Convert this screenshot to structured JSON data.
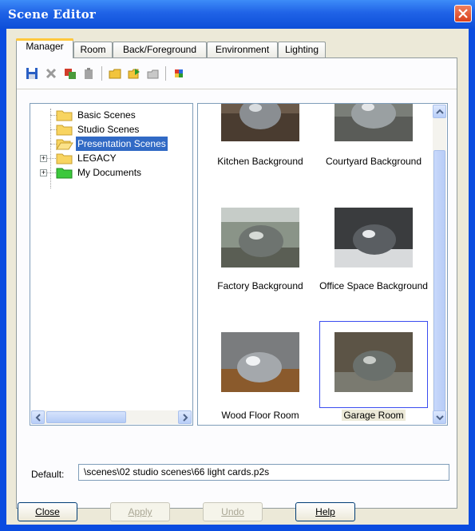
{
  "window": {
    "title": "Scene Editor"
  },
  "tabs": [
    {
      "label": "Manager",
      "active": true
    },
    {
      "label": "Room",
      "active": false
    },
    {
      "label": "Back/Foreground",
      "active": false
    },
    {
      "label": "Environment",
      "active": false
    },
    {
      "label": "Lighting",
      "active": false
    }
  ],
  "toolbar": {
    "icons": [
      "save-icon",
      "delete-icon",
      "copy-icon",
      "paste-icon",
      "new-folder-icon",
      "open-folder-icon",
      "up-folder-icon",
      "color-icon"
    ]
  },
  "tree": {
    "items": [
      {
        "label": "Basic Scenes",
        "icon": "folder-icon"
      },
      {
        "label": "Studio Scenes",
        "icon": "folder-icon"
      },
      {
        "label": "Presentation Scenes",
        "icon": "open-folder-icon",
        "selected": true
      },
      {
        "label": "LEGACY",
        "icon": "folder-icon",
        "expander": "+"
      },
      {
        "label": "My Documents",
        "icon": "green-folder-icon",
        "expander": "+"
      }
    ]
  },
  "gallery": {
    "scenes": [
      {
        "label": "Kitchen Background"
      },
      {
        "label": "Courtyard Background"
      },
      {
        "label": "Factory Background"
      },
      {
        "label": "Office Space Background"
      },
      {
        "label": "Wood Floor Room"
      },
      {
        "label": "Garage Room",
        "selected": true
      }
    ]
  },
  "default": {
    "label": "Default:",
    "value": "\\scenes\\02 studio scenes\\66 light cards.p2s"
  },
  "buttons": {
    "close": "Close",
    "apply": "Apply",
    "undo": "Undo",
    "help": "Help"
  },
  "colors": {
    "titlebar": "#1f62e6",
    "selection": "#316ac5",
    "dialog_bg": "#ece9d8"
  }
}
